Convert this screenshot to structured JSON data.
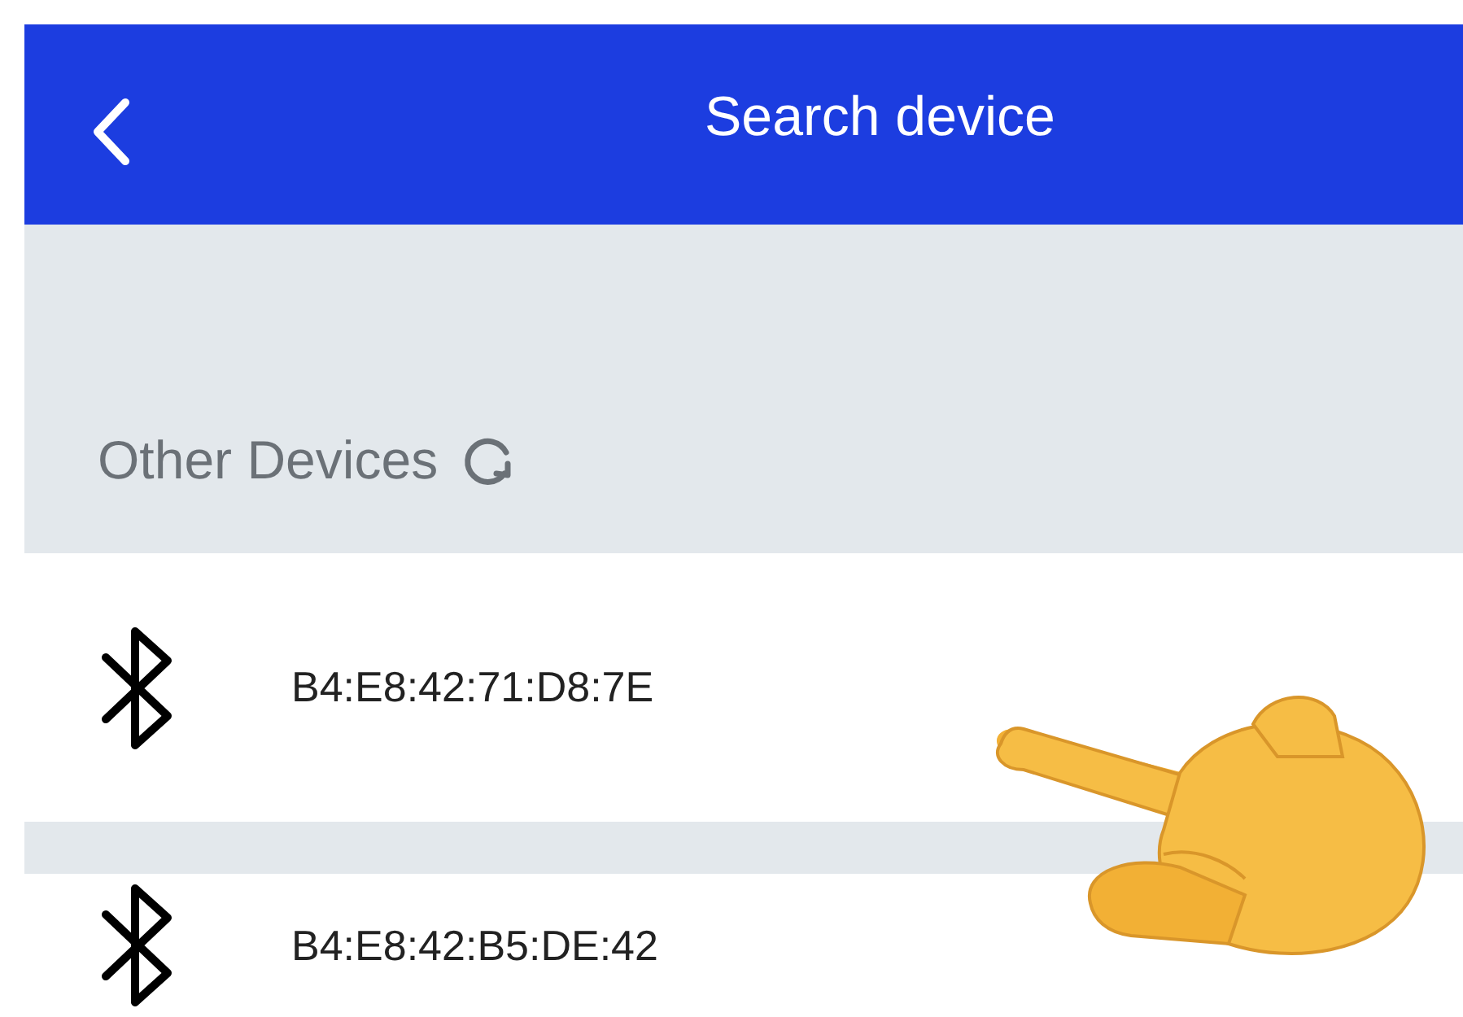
{
  "header": {
    "title": "Search device"
  },
  "section": {
    "title": "Other Devices"
  },
  "devices": [
    {
      "name": "B4:E8:42:71:D8:7E"
    },
    {
      "name": "B4:E8:42:B5:DE:42"
    }
  ]
}
